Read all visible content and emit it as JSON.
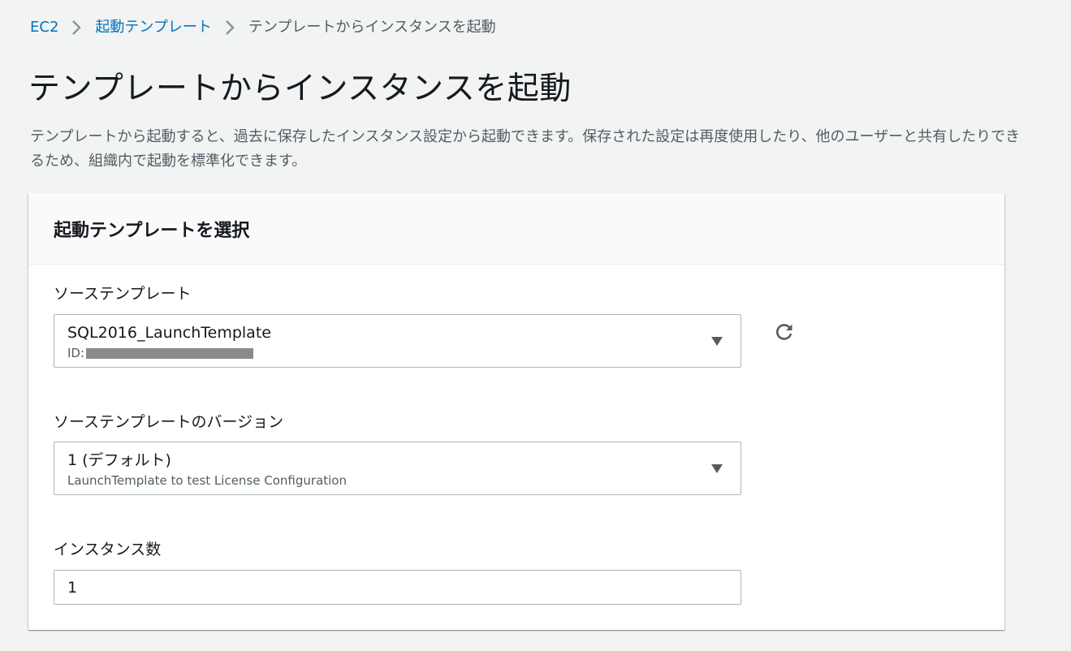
{
  "breadcrumb": {
    "items": [
      "EC2",
      "起動テンプレート"
    ],
    "current": "テンプレートからインスタンスを起動"
  },
  "page": {
    "title": "テンプレートからインスタンスを起動",
    "description": "テンプレートから起動すると、過去に保存したインスタンス設定から起動できます。保存された設定は再度使用したり、他のユーザーと共有したりできるため、組織内で起動を標準化できます。"
  },
  "panel": {
    "title": "起動テンプレートを選択",
    "source_template": {
      "label": "ソーステンプレート",
      "value": "SQL2016_LaunchTemplate",
      "id_prefix": "ID:"
    },
    "source_version": {
      "label": "ソーステンプレートのバージョン",
      "value": "1 (デフォルト)",
      "description": "LaunchTemplate to test License Configuration"
    },
    "instance_count": {
      "label": "インスタンス数",
      "value": "1"
    }
  },
  "colors": {
    "link": "#0073bb",
    "background": "#f2f3f3",
    "border": "#aab7b8"
  }
}
